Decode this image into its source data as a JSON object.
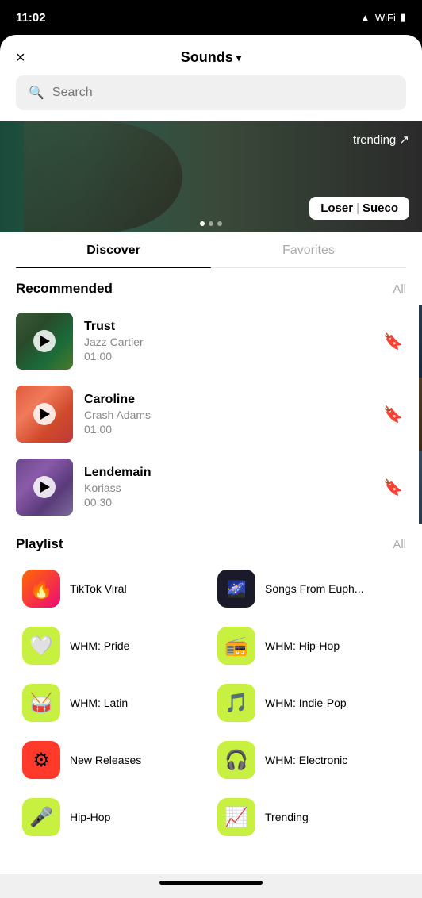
{
  "statusBar": {
    "time": "11:02",
    "icons": [
      "signal",
      "wifi",
      "battery"
    ]
  },
  "header": {
    "closeLabel": "×",
    "title": "Sounds",
    "chevron": "▾"
  },
  "search": {
    "placeholder": "Search"
  },
  "banner": {
    "trendingLabel": "trending ↗",
    "artistName": "Loser",
    "separator": "|",
    "artistSub": "Sueco"
  },
  "tabs": [
    {
      "id": "discover",
      "label": "Discover",
      "active": true
    },
    {
      "id": "favorites",
      "label": "Favorites",
      "active": false
    }
  ],
  "recommended": {
    "title": "Recommended",
    "allLabel": "All",
    "tracks": [
      {
        "id": "trust",
        "name": "Trust",
        "artist": "Jazz Cartier",
        "duration": "01:00",
        "thumbClass": "track-thumb-trust"
      },
      {
        "id": "caroline",
        "name": "Caroline",
        "artist": "Crash Adams",
        "duration": "01:00",
        "thumbClass": "track-thumb-caroline"
      },
      {
        "id": "lendemain",
        "name": "Lendemain",
        "artist": "Koriass",
        "duration": "00:30",
        "thumbClass": "track-thumb-lendemain"
      }
    ]
  },
  "playlist": {
    "title": "Playlist",
    "allLabel": "All",
    "items": [
      {
        "id": "tiktok-viral",
        "name": "TikTok Viral",
        "iconClass": "icon-tiktok-viral",
        "icon": "🔥"
      },
      {
        "id": "songs-euph",
        "name": "Songs From Euph...",
        "iconClass": "icon-songs-euph",
        "icon": "🌌"
      },
      {
        "id": "whm-pride",
        "name": "WHM: Pride",
        "iconClass": "icon-whm-pride",
        "icon": "🤍"
      },
      {
        "id": "whm-hiphop",
        "name": "WHM: Hip-Hop",
        "iconClass": "icon-whm-hiphop",
        "icon": "📻"
      },
      {
        "id": "whm-latin",
        "name": "WHM: Latin",
        "iconClass": "icon-whm-latin",
        "icon": "🥁"
      },
      {
        "id": "whm-indiepop",
        "name": "WHM: Indie-Pop",
        "iconClass": "icon-whm-indiepop",
        "icon": "🎵"
      },
      {
        "id": "new-releases",
        "name": "New Releases",
        "iconClass": "icon-new-releases",
        "icon": "⚙"
      },
      {
        "id": "whm-electronic",
        "name": "WHM: Electronic",
        "iconClass": "icon-whm-electronic",
        "icon": "🎧"
      }
    ]
  }
}
